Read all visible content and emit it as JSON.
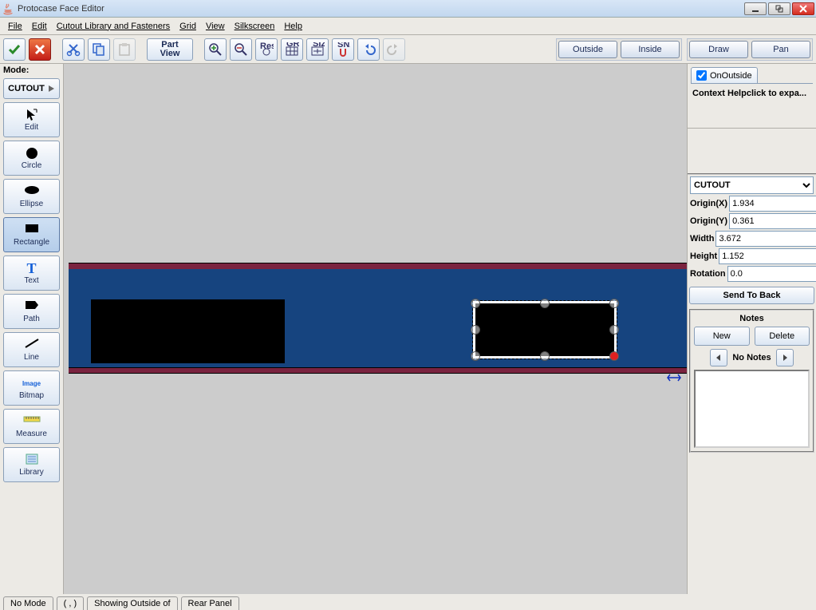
{
  "window": {
    "title": "Protocase Face Editor"
  },
  "menu": {
    "file": "File",
    "edit": "Edit",
    "cutout": "Cutout Library and Fasteners",
    "grid": "Grid",
    "view": "View",
    "silkscreen": "Silkscreen",
    "help": "Help"
  },
  "toolbar": {
    "part_view_l1": "Part",
    "part_view_l2": "View",
    "outside": "Outside",
    "inside": "Inside",
    "draw": "Draw",
    "pan": "Pan"
  },
  "left": {
    "mode_label": "Mode:",
    "cutout": "CUTOUT",
    "edit": "Edit",
    "circle": "Circle",
    "ellipse": "Ellipse",
    "rectangle": "Rectangle",
    "text": "Text",
    "path": "Path",
    "line": "Line",
    "bitmap": "Bitmap",
    "measure": "Measure",
    "library": "Library",
    "image_word": "Image"
  },
  "right": {
    "on_outside": "OnOutside",
    "context_help": "Context Helpclick to expa...",
    "type_options": [
      "CUTOUT"
    ],
    "type_value": "CUTOUT",
    "originx_label": "Origin(X)",
    "originy_label": "Origin(Y)",
    "width_label": "Width",
    "height_label": "Height",
    "rotation_label": "Rotation",
    "originx": "1.934",
    "originy": "0.361",
    "width": "3.672",
    "height": "1.152",
    "rotation": "0.0",
    "send_to_back": "Send To Back",
    "notes_title": "Notes",
    "new": "New",
    "delete": "Delete",
    "no_notes": "No Notes"
  },
  "status": {
    "no_mode": "No Mode",
    "paren": "( , )",
    "showing": "Showing Outside of",
    "rear": "Rear Panel"
  }
}
